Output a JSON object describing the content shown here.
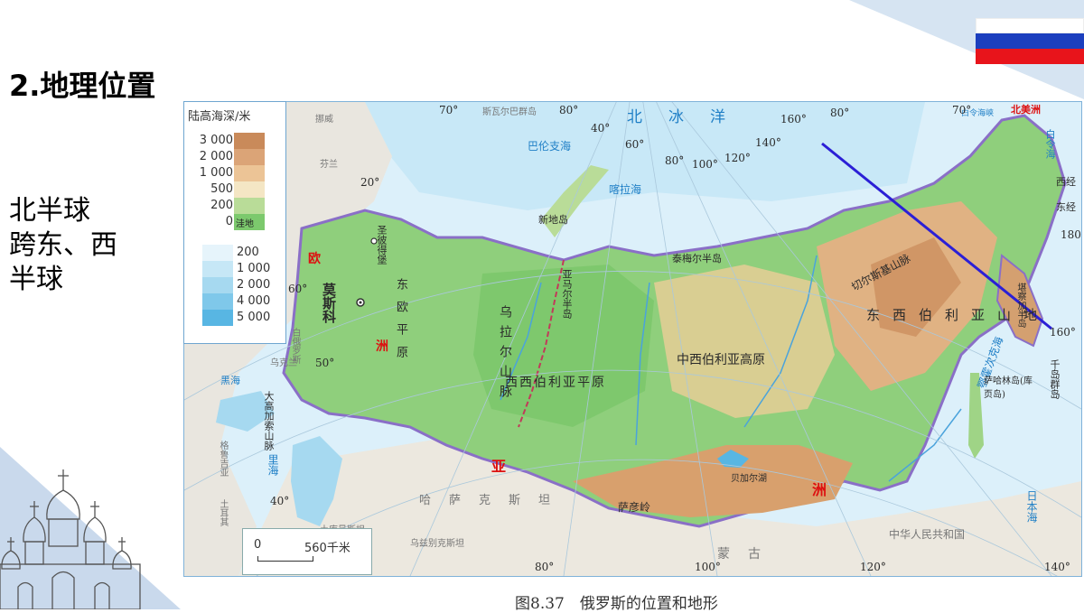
{
  "slide": {
    "title": "2.地理位置",
    "body_lines": [
      "北半球",
      "跨东、西",
      "半球"
    ]
  },
  "colors": {
    "russia_flag": [
      "#ffffff",
      "#1c3fbe",
      "#e8141b"
    ],
    "annotation_line": "#2b1fd6"
  },
  "legend": {
    "title": "陆高海深/米",
    "land": [
      {
        "label": "3 000",
        "color": "#c98a5a"
      },
      {
        "label": "2 000",
        "color": "#dba477"
      },
      {
        "label": "1 000",
        "color": "#ecc496"
      },
      {
        "label": "500",
        "color": "#f4e6c4"
      },
      {
        "label": "200",
        "color": "#b9dc98"
      },
      {
        "label": "0",
        "color": "#7cc96d"
      }
    ],
    "lowland_label": "洼地",
    "sea": [
      {
        "label": "200",
        "color": "#e6f4fb"
      },
      {
        "label": "1 000",
        "color": "#c6e7f6"
      },
      {
        "label": "2 000",
        "color": "#a6d9f0"
      },
      {
        "label": "4 000",
        "color": "#7fc8ea"
      },
      {
        "label": "5 000",
        "color": "#58b6e3"
      }
    ]
  },
  "scale": {
    "start": "0",
    "end": "560千米"
  },
  "caption": "图8.37　俄罗斯的位置和地形",
  "map_labels": {
    "ocean": "北　冰　洋",
    "barents": "巴伦支海",
    "kara": "喀拉海",
    "novaya": "新地岛",
    "yamal": "亚马尔半岛",
    "taimyr": "泰梅尔半岛",
    "europe_a": "欧",
    "europe_b": "洲",
    "asia_a": "亚",
    "asia_b": "洲",
    "north_america": "北美洲",
    "moscow": "莫斯科",
    "stpetersburg": "圣彼得堡",
    "east_euro_plain": "东欧平原",
    "ural": "乌拉尔山脉",
    "west_siberia": "西西伯利亚平原",
    "central_siberia": "中西伯利亚高原",
    "east_siberia": "东西伯利亚山地",
    "cherskiy": "切尔斯基山脉",
    "okhotsk": "鄂霍次克海",
    "sakhalin": "萨哈林岛(库页岛)",
    "kamchatka": "堪察加半岛",
    "kuril": "千岛群岛",
    "japan_sea": "日本海",
    "bering": "白令海",
    "bering_strait": "白令海峡",
    "caucasus": "大高加索山脉",
    "caspian": "里海",
    "black_sea": "黑海",
    "baikal": "贝加尔湖",
    "sayan": "萨彦岭",
    "mongolia": "蒙古",
    "kazakhstan": "哈萨克斯坦",
    "china": "中华人民共和国",
    "uzbek": "乌兹别克斯坦",
    "finland": "芬兰",
    "norway": "挪威",
    "belarus": "白俄罗斯",
    "ukraine": "乌克兰",
    "georgia": "格鲁吉亚",
    "turkey": "土耳其",
    "turkmen": "土库曼斯坦",
    "franz": "斯瓦尔巴群岛",
    "west_180": "西经",
    "east_180": "东经",
    "lon_labels": [
      "70°",
      "80°",
      "40°",
      "60°",
      "80°",
      "100°",
      "120°",
      "140°",
      "160°",
      "80°",
      "70°",
      "160°",
      "180°",
      "80°",
      "100°",
      "120°",
      "140°",
      "50°",
      "40°",
      "20°",
      "60°"
    ]
  }
}
